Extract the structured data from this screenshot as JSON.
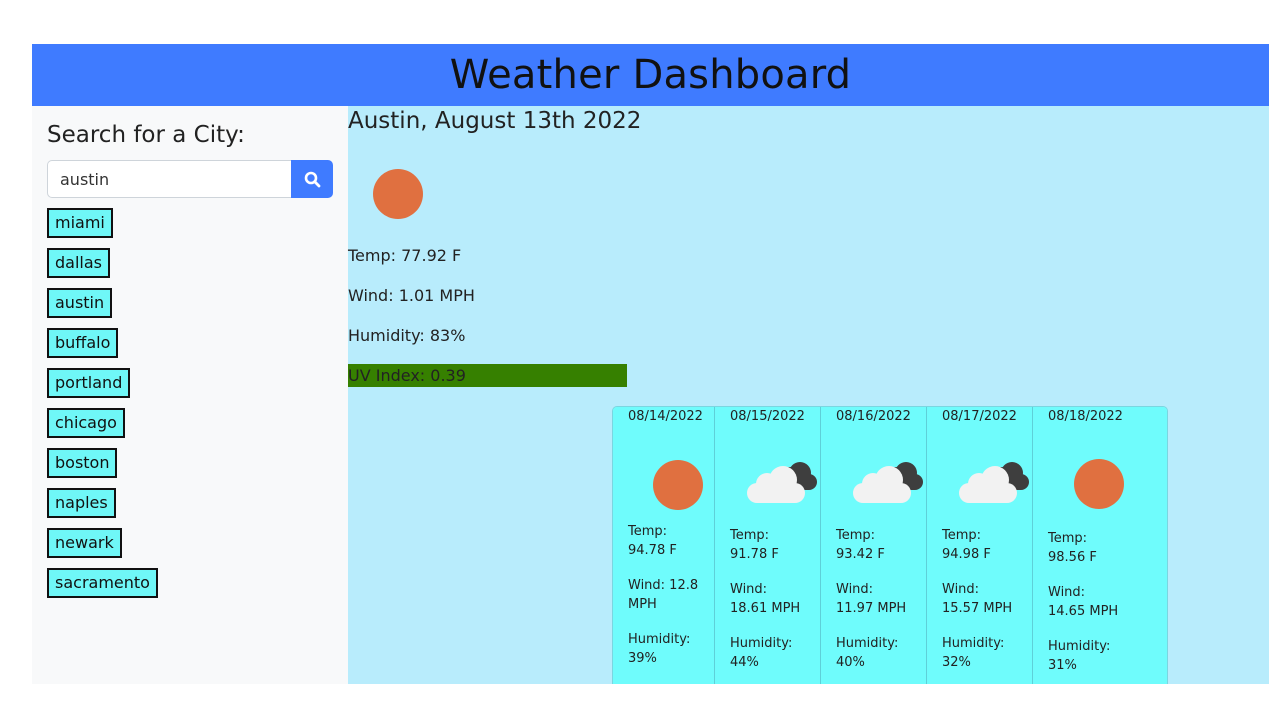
{
  "header": {
    "title": "Weather Dashboard"
  },
  "sidebar": {
    "title": "Search for a City:",
    "search_value": "austin",
    "search_icon": "search-icon",
    "history": [
      "miami",
      "dallas",
      "austin",
      "buffalo",
      "portland",
      "chicago",
      "boston",
      "naples",
      "newark",
      "sacramento"
    ]
  },
  "current": {
    "city_date": "Austin, August 13th 2022",
    "icon": "sun-icon",
    "temp": "Temp: 77.92 F",
    "wind": "Wind: 1.01 MPH",
    "humidity": "Humidity: 83%",
    "uv": "UV Index: 0.39"
  },
  "forecast": [
    {
      "date": "08/14/2022",
      "icon": "sun-icon",
      "temp_label": "Temp:",
      "temp": "94.78 F",
      "wind_label": "Wind: 12.8",
      "wind": "MPH",
      "humidity_label": "Humidity:",
      "humidity": "39%"
    },
    {
      "date": "08/15/2022",
      "icon": "cloudy-icon",
      "temp_label": "Temp:",
      "temp": "91.78 F",
      "wind_label": "Wind:",
      "wind": "18.61 MPH",
      "humidity_label": "Humidity:",
      "humidity": "44%"
    },
    {
      "date": "08/16/2022",
      "icon": "cloudy-icon",
      "temp_label": "Temp:",
      "temp": "93.42 F",
      "wind_label": "Wind:",
      "wind": "11.97 MPH",
      "humidity_label": "Humidity:",
      "humidity": "40%"
    },
    {
      "date": "08/17/2022",
      "icon": "cloudy-icon",
      "temp_label": "Temp:",
      "temp": "94.98 F",
      "wind_label": "Wind:",
      "wind": "15.57 MPH",
      "humidity_label": "Humidity:",
      "humidity": "32%"
    },
    {
      "date": "08/18/2022",
      "icon": "sun-icon",
      "temp_label": "Temp:",
      "temp": "98.56 F",
      "wind_label": "Wind:",
      "wind": "14.65 MPH",
      "humidity_label": "Humidity:",
      "humidity": "31%"
    }
  ],
  "colors": {
    "header": "#3f7bff",
    "sidebar": "#f8f9fa",
    "main": "#b8ecfc",
    "history_button": "#6ff7f7",
    "card": "#6ffcfc",
    "uv": "#368000",
    "sun": "#e07040"
  }
}
